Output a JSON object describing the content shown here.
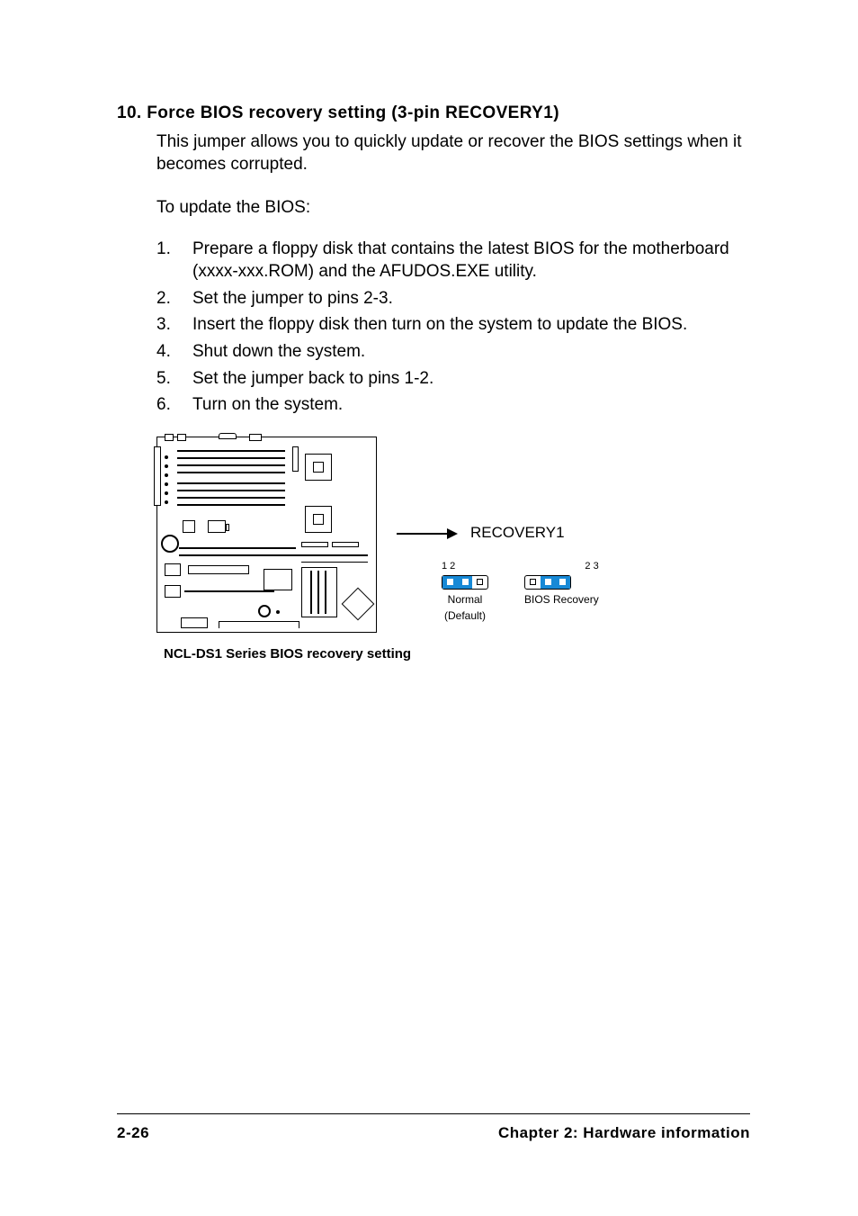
{
  "section": {
    "heading": "10. Force BIOS recovery setting (3-pin RECOVERY1)",
    "intro": "This jumper allows you to quickly update or recover the BIOS settings when it becomes corrupted.",
    "subhead": "To update the BIOS:",
    "steps": [
      "Prepare a floppy disk that contains the latest BIOS for the motherboard (xxxx-xxx.ROM) and the AFUDOS.EXE utility.",
      "Set the jumper to pins 2-3.",
      "Insert the floppy disk then turn on the system to update the BIOS.",
      "Shut down the system.",
      "Set the jumper back to pins 1-2.",
      "Turn on the system."
    ]
  },
  "diagram": {
    "connector_label": "RECOVERY1",
    "jumper_a": {
      "pins": "1 2",
      "label1": "Normal",
      "label2": "(Default)"
    },
    "jumper_b": {
      "pins": "2 3",
      "label1": "BIOS Recovery"
    },
    "caption": "NCL-DS1 Series BIOS recovery setting"
  },
  "footer": {
    "left": "2-26",
    "right": "Chapter 2: Hardware information"
  }
}
